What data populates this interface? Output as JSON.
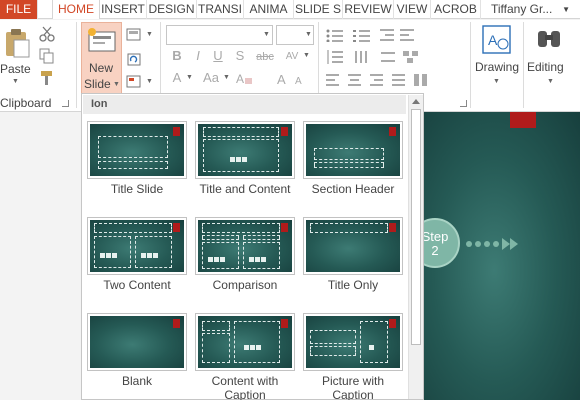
{
  "tabs": [
    "FILE",
    "HOME",
    "INSERT",
    "DESIGN",
    "TRANSI",
    "ANIMA",
    "SLIDE S",
    "REVIEW",
    "VIEW",
    "ACROB"
  ],
  "user": {
    "name": "Tiffany Gr..."
  },
  "ribbon": {
    "clipboard": {
      "paste": "Paste",
      "group_label": "Clipboard"
    },
    "slides": {
      "new_slide_line1": "New",
      "new_slide_line2": "Slide"
    },
    "font": {
      "bold": "B",
      "italic": "I",
      "underline": "U",
      "strike": "S",
      "strike_alt": "abc",
      "spacing": "AV",
      "grow": "A",
      "case": "Aa"
    },
    "drawing": {
      "label": "Drawing"
    },
    "editing": {
      "label": "Editing"
    }
  },
  "gallery": {
    "theme_name": "Ion",
    "layouts": [
      {
        "label_line1": "Title Slide",
        "label_line2": ""
      },
      {
        "label_line1": "Title and Content",
        "label_line2": ""
      },
      {
        "label_line1": "Section Header",
        "label_line2": ""
      },
      {
        "label_line1": "Two Content",
        "label_line2": ""
      },
      {
        "label_line1": "Comparison",
        "label_line2": ""
      },
      {
        "label_line1": "Title Only",
        "label_line2": ""
      },
      {
        "label_line1": "Blank",
        "label_line2": ""
      },
      {
        "label_line1": "Content with",
        "label_line2": "Caption"
      },
      {
        "label_line1": "Picture with",
        "label_line2": "Caption"
      }
    ]
  },
  "slide": {
    "step_word": "Step",
    "step_number": "2"
  },
  "colors": {
    "file_tab": "#d24726",
    "accent_red": "#b01b1b",
    "slide_teal": "#255a55",
    "step_circle": "#7fb6a6"
  }
}
